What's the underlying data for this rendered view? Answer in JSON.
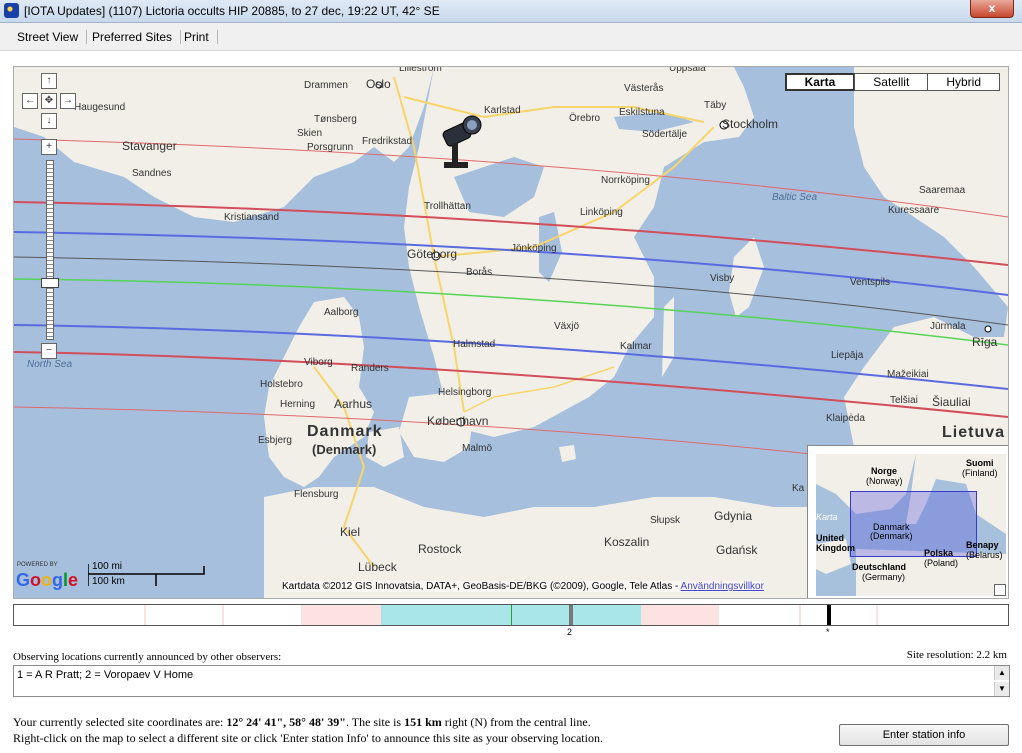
{
  "window": {
    "title": "[IOTA Updates] (1107) Lictoria occults HIP 20885, to 27 dec, 19:22 UT, 42° SE",
    "close_label": "x"
  },
  "menu": {
    "items": [
      {
        "label": "Street View"
      },
      {
        "label": "Preferred Sites"
      },
      {
        "label": "Print"
      }
    ]
  },
  "map": {
    "type_buttons": [
      {
        "label": "Karta",
        "active": true
      },
      {
        "label": "Satellit",
        "active": false
      },
      {
        "label": "Hybrid",
        "active": false
      }
    ],
    "nav": {
      "up": "↑",
      "left": "←",
      "center": "✥",
      "right": "→",
      "down": "↓",
      "zoom_in": "+",
      "zoom_out": "−"
    },
    "scale": {
      "miles": "100 mi",
      "km": "100 km"
    },
    "logo": {
      "powered": "POWERED BY",
      "name": "Google"
    },
    "attribution": "Kartdata ©2012 GIS Innovatsia, DATA+, GeoBasis-DE/BKG (©2009), Google, Tele Atlas - ",
    "attribution_link": "Användningsvillkor",
    "labels": {
      "lillestrom": "Lillestrom",
      "oppsala": "Uppsala",
      "drammen": "Drammen",
      "oslo": "Oslo",
      "vasteras": "Västerås",
      "taby": "Täby",
      "haugesund": "Haugesund",
      "tonsberg": "Tønsberg",
      "karlstad": "Karlstad",
      "orebro": "Örebro",
      "eskilstuna": "Eskilstuna",
      "stockholm": "Stockholm",
      "skien": "Skien",
      "fredrikstad": "Fredrikstad",
      "sodertalje": "Södertälje",
      "stavanger": "Stavanger",
      "porsgrunn": "Porsgrunn",
      "sandnes": "Sandnes",
      "norrkoping": "Norrköping",
      "linkoping": "Linköping",
      "baltic_sea": "Baltic Sea",
      "trollhattan": "Trollhättan",
      "kristiansand": "Kristiansand",
      "saaremaa": "Saaremaa",
      "kuressaare": "Kuressaare",
      "jonkoping": "Jönköping",
      "goteborg": "Göteborg",
      "boras": "Borås",
      "visby": "Visby",
      "ventspils": "Ventspils",
      "aalborg": "Aalborg",
      "vaxjo": "Växjö",
      "jurmala": "Jūrmala",
      "riga": "Rīga",
      "halmstad": "Halmstad",
      "kalmar": "Kalmar",
      "north_sea": "North Sea",
      "viborg": "Viborg",
      "randers": "Randers",
      "liepaja": "Liepāja",
      "holstebro": "Holstebro",
      "mazeikiai": "Mažeikiai",
      "helsingborg": "Helsingborg",
      "herning": "Herning",
      "aarhus": "Aarhus",
      "telsiai": "Telšiai",
      "siauliai": "Šiauliai",
      "kobenhavn": "København",
      "danmark": "Danmark",
      "denmark": "(Denmark)",
      "esbjerg": "Esbjerg",
      "malmo": "Malmö",
      "klaipeda": "Klaipėda",
      "lietuva": "Lietuva",
      "flensburg": "Flensburg",
      "kiel": "Kiel",
      "gdynia": "Gdynia",
      "slupsk": "Słupsk",
      "rostock": "Rostock",
      "koszalin": "Koszalin",
      "gdansk": "Gdańsk",
      "lubeck": "Lübeck",
      "ka": "Ka"
    },
    "overview": {
      "norge": "Norge",
      "norway": "(Norway)",
      "suomi": "Suomi",
      "finland": "(Finland)",
      "karta": "Karta",
      "danmark": "Danmark",
      "denmark": "(Denmark)",
      "united": "United",
      "kingdom": "Kingdom",
      "benapy": "Benapy",
      "belarus": "(Belarus)",
      "polska": "Polska",
      "poland": "(Poland)",
      "deutschland": "Deutschland",
      "germany": "(Germany)"
    }
  },
  "timeline": {
    "labels": {
      "site": "2",
      "current": "*"
    }
  },
  "observers": {
    "heading": "Observing locations currently announced by other observers:",
    "resolution": "Site resolution: 2.2 km",
    "list": "1 = A R Pratt; 2 = Voropaev V Home"
  },
  "site": {
    "intro": "Your currently selected site coordinates are: ",
    "coords": "12° 24' 41\", 58° 48' 39\"",
    "mid": ". The site is ",
    "distance": "151 km",
    "tail": " right (N) from the central line.",
    "instruction": "Right-click on the map to select a different site or click 'Enter station Info' to announce this site as your observing location."
  },
  "buttons": {
    "enter_station": "Enter station info"
  },
  "colors": {
    "sea": "#a5bfdd",
    "land": "#f2efe8",
    "central_line": "#55d455",
    "path_limit": "#5a6be0",
    "sigma_line": "#e06a6a",
    "timeline_cyan": "#a8e6ea",
    "timeline_pink": "#fde2e2"
  }
}
